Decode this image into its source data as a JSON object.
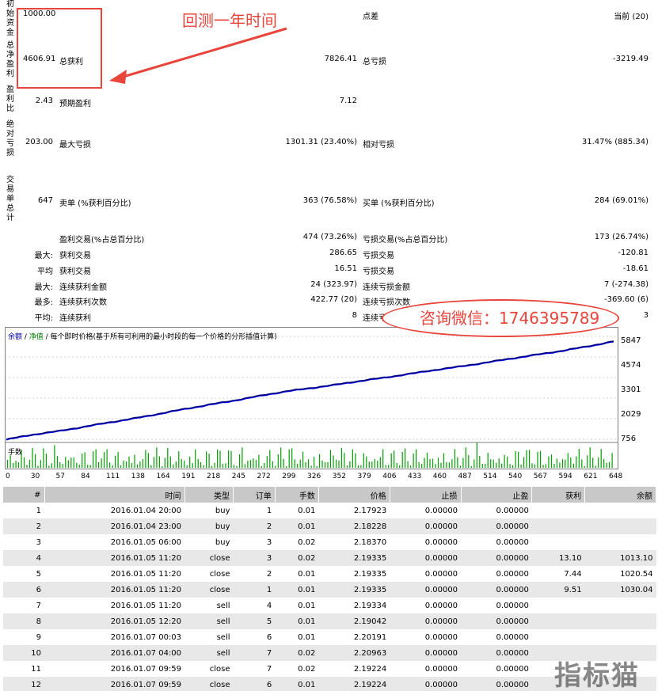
{
  "stats": {
    "initial_deposit_label": "初始资金",
    "initial_deposit": "1000.00",
    "spread_label": "点差",
    "spread_value": "当前 (20)",
    "net_profit_label": "总净盈利",
    "net_profit": "4606.91",
    "gross_profit_label": "总获利",
    "gross_profit": "7826.41",
    "gross_loss_label": "总亏损",
    "gross_loss": "-3219.49",
    "profit_factor_label": "盈利比",
    "profit_factor": "2.43",
    "expected_payoff_label": "预期盈利",
    "expected_payoff": "7.12",
    "abs_drawdown_label": "绝对亏损",
    "abs_drawdown": "203.00",
    "max_drawdown_label": "最大亏损",
    "max_drawdown": "1301.31 (23.40%)",
    "rel_drawdown_label": "相对亏损",
    "rel_drawdown": "31.47% (885.34)",
    "total_trades_label": "交易单总计",
    "total_trades": "647",
    "short_label": "卖单 (%获利百分比)",
    "short_value": "363 (76.58%)",
    "long_label": "买单 (%获利百分比)",
    "long_value": "284 (69.01%)",
    "profit_trades_label": "盈利交易(%占总百分比)",
    "profit_trades": "474 (73.26%)",
    "loss_trades_label": "亏损交易(%占总百分比)",
    "loss_trades": "173 (26.74%)",
    "r1_prefix": "最大:",
    "r1_a_label": "获利交易",
    "r1_a_value": "286.65",
    "r1_b_label": "亏损交易",
    "r1_b_value": "-120.81",
    "r2_prefix": "平均",
    "r2_a_label": "获利交易",
    "r2_a_value": "16.51",
    "r2_b_label": "亏损交易",
    "r2_b_value": "-18.61",
    "r3_prefix": "最大:",
    "r3_a_label": "连续获利金额",
    "r3_a_value": "24 (323.97)",
    "r3_b_label": "连续亏损金额",
    "r3_b_value": "7 (-274.38)",
    "r4_prefix": "最多:",
    "r4_a_label": "连续获利次数",
    "r4_a_value": "422.77 (20)",
    "r4_b_label": "连续亏损次数",
    "r4_b_value": "-369.60 (6)",
    "r5_prefix": "平均:",
    "r5_a_label": "连续获利",
    "r5_a_value": "8",
    "r5_b_label": "连续亏损",
    "r5_b_value": "3"
  },
  "annotations": {
    "backtest_note": "回测一年时间",
    "wechat_note": "咨询微信：1746395789",
    "watermark": "指标猫"
  },
  "chart": {
    "title_balance": "余额",
    "title_sep1": " / ",
    "title_equity": "净值",
    "title_rest": " / 每个即时价格(基于所有可利用的最小时段的每一个价格的分形插值计算)",
    "volume_label": "手数",
    "balance_color": "#00007f",
    "equity_color": "#0000ff",
    "volume_color": "#00a000"
  },
  "chart_data": {
    "type": "line",
    "ylim": [
      756,
      6100
    ],
    "y_ticks": [
      "5847",
      "4574",
      "3301",
      "2029",
      "756"
    ],
    "x_ticks": [
      "0",
      "30",
      "57",
      "84",
      "111",
      "138",
      "164",
      "191",
      "218",
      "245",
      "272",
      "299",
      "326",
      "352",
      "379",
      "406",
      "433",
      "460",
      "487",
      "514",
      "540",
      "567",
      "594",
      "621",
      "648"
    ],
    "series": [
      {
        "values": [
          756,
          1000,
          1180,
          1400,
          1630,
          1840,
          2080,
          2330,
          2560,
          2780,
          3020,
          3250,
          3420,
          3600,
          3800,
          3980,
          4180,
          4380,
          4560,
          4760,
          4970,
          5170,
          5370,
          5600,
          5850
        ]
      }
    ]
  },
  "table": {
    "columns": [
      "#",
      "时间",
      "类型",
      "订单",
      "手数",
      "价格",
      "止损",
      "止盈",
      "获利",
      "余额"
    ],
    "rows": [
      [
        "1",
        "2016.01.04 20:00",
        "buy",
        "1",
        "0.01",
        "2.17923",
        "0.00000",
        "0.00000",
        "",
        ""
      ],
      [
        "2",
        "2016.01.04 23:00",
        "buy",
        "2",
        "0.01",
        "2.18228",
        "0.00000",
        "0.00000",
        "",
        ""
      ],
      [
        "3",
        "2016.01.05 06:00",
        "buy",
        "3",
        "0.02",
        "2.18370",
        "0.00000",
        "0.00000",
        "",
        ""
      ],
      [
        "4",
        "2016.01.05 11:20",
        "close",
        "3",
        "0.02",
        "2.19335",
        "0.00000",
        "0.00000",
        "13.10",
        "1013.10"
      ],
      [
        "5",
        "2016.01.05 11:20",
        "close",
        "2",
        "0.01",
        "2.19335",
        "0.00000",
        "0.00000",
        "7.44",
        "1020.54"
      ],
      [
        "6",
        "2016.01.05 11:20",
        "close",
        "1",
        "0.01",
        "2.19335",
        "0.00000",
        "0.00000",
        "9.51",
        "1030.04"
      ],
      [
        "7",
        "2016.01.05 11:20",
        "sell",
        "4",
        "0.01",
        "2.19334",
        "0.00000",
        "0.00000",
        "",
        ""
      ],
      [
        "8",
        "2016.01.05 12:20",
        "sell",
        "5",
        "0.01",
        "2.19042",
        "0.00000",
        "0.00000",
        "",
        ""
      ],
      [
        "9",
        "2016.01.07 00:03",
        "sell",
        "6",
        "0.01",
        "2.20191",
        "0.00000",
        "0.00000",
        "",
        ""
      ],
      [
        "10",
        "2016.01.07 04:00",
        "sell",
        "7",
        "0.02",
        "2.20963",
        "0.00000",
        "0.00000",
        "",
        ""
      ],
      [
        "11",
        "2016.01.07 09:59",
        "close",
        "7",
        "0.02",
        "2.19224",
        "0.00000",
        "0.00000",
        "",
        ""
      ],
      [
        "12",
        "2016.01.07 09:59",
        "close",
        "6",
        "0.01",
        "2.19224",
        "0.00000",
        "0.00000",
        "",
        ""
      ]
    ]
  }
}
